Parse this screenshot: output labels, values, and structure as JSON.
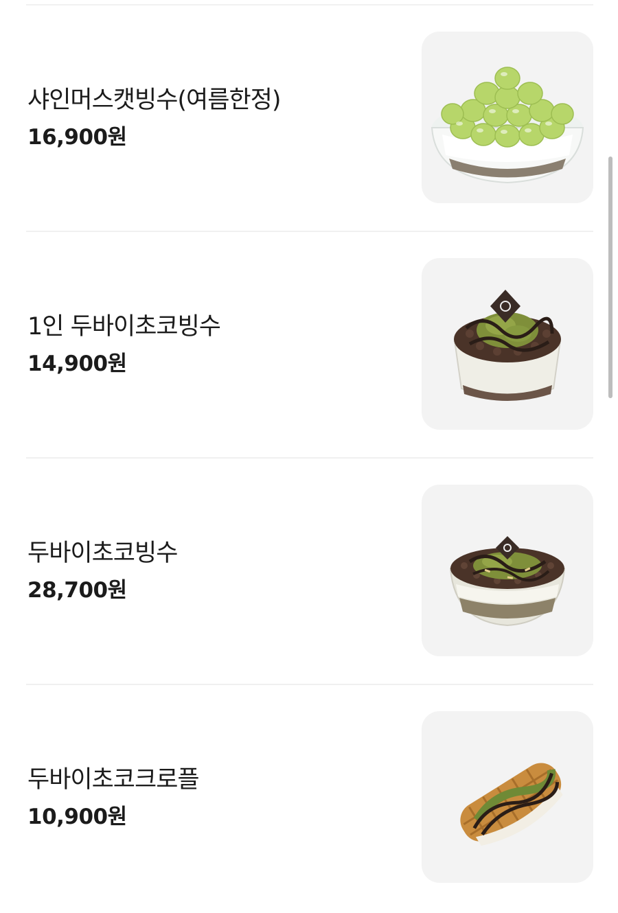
{
  "menu": {
    "items": [
      {
        "name": "샤인머스캣빙수(여름한정)",
        "price": "16,900원",
        "image": "shine-muscat-bingsu-image"
      },
      {
        "name": "1인 두바이초코빙수",
        "price": "14,900원",
        "image": "dubai-choco-bingsu-single-image"
      },
      {
        "name": "두바이초코빙수",
        "price": "28,700원",
        "image": "dubai-choco-bingsu-image"
      },
      {
        "name": "두바이초코크로플",
        "price": "10,900원",
        "image": "dubai-choco-croffle-image"
      }
    ]
  },
  "colors": {
    "page_background": "#ffffff",
    "thumbnail_background": "#f3f3f3",
    "text": "#1b1b1b",
    "divider": "#f0f0f0",
    "scrollbar": "#bdbdbd"
  }
}
